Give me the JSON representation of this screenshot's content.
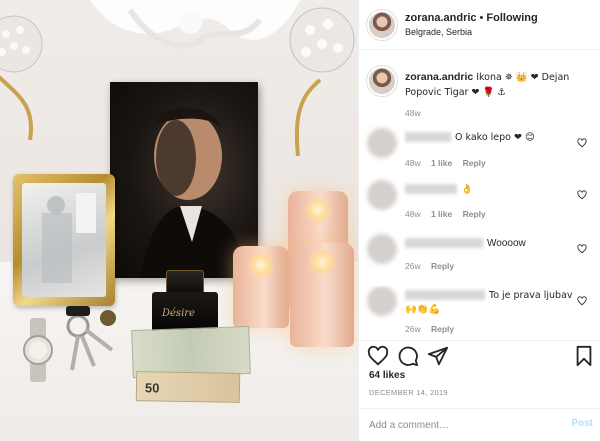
{
  "post": {
    "image_alt": "Photo of a dresser with a portrait, gold mirror, candles, perfume, keys, watch and banknotes",
    "perfume_brand": "Désire",
    "euro_note": "50"
  },
  "header": {
    "username": "zorana.andric",
    "separator": "•",
    "follow_status": "Following",
    "location": "Belgrade, Serbia"
  },
  "caption": {
    "username": "zorana.andric",
    "text": "Ikona ✵ 👑 ❤ Dejan Popovic Tigar ❤ 🌹 ⚓",
    "time": "48w"
  },
  "comments": [
    {
      "text": "O kako lepo ❤ 😊",
      "time": "48w",
      "likes": "1 like",
      "reply": "Reply"
    },
    {
      "text": "👌",
      "time": "48w",
      "likes": "1 like",
      "reply": "Reply"
    },
    {
      "text": "Woooow",
      "time": "26w",
      "likes": "",
      "reply": "Reply"
    },
    {
      "text": "To je prava ljubav 🙌👏💪",
      "time": "26w",
      "likes": "",
      "reply": "Reply"
    }
  ],
  "actions": {
    "icons": [
      "heart-icon",
      "comment-icon",
      "share-icon",
      "bookmark-icon"
    ]
  },
  "likes_count": "64 likes",
  "post_date": "DECEMBER 14, 2019",
  "add_comment": {
    "placeholder": "Add a comment…",
    "post_label": "Post"
  },
  "colors": {
    "text": "#262626",
    "muted": "#8e8e8e",
    "post_disabled": "#b2dffc",
    "heart_red": "#ed4956",
    "divider": "#efefef"
  }
}
